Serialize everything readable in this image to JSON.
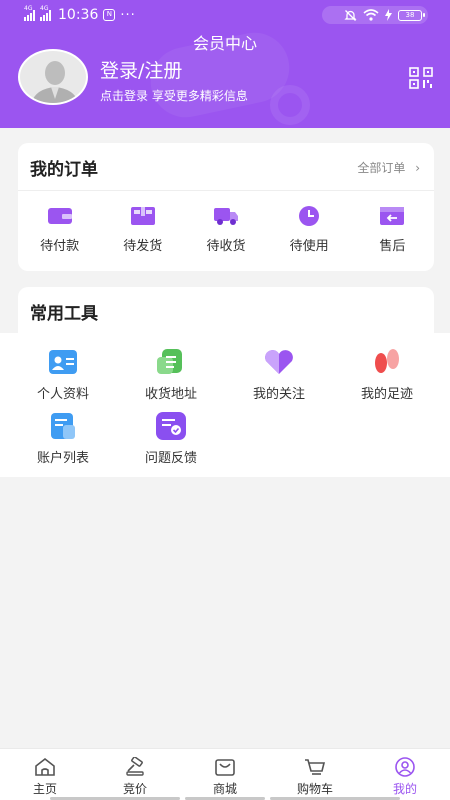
{
  "status_bar": {
    "network_1": "4G",
    "network_2": "4G",
    "time": "10:36",
    "notif_badge": "N",
    "more_dots": "···",
    "battery_level": "38"
  },
  "header": {
    "title": "会员中心",
    "login_title": "登录/注册",
    "login_subtitle": "点击登录 享受更多精彩信息",
    "qr_icon": "qr-code-icon",
    "bg_color": "#9b55f0"
  },
  "orders": {
    "title": "我的订单",
    "all_orders_label": "全部订单",
    "items": [
      {
        "label": "待付款",
        "icon": "wallet-icon"
      },
      {
        "label": "待发货",
        "icon": "package-icon"
      },
      {
        "label": "待收货",
        "icon": "truck-icon"
      },
      {
        "label": "待使用",
        "icon": "clock-icon"
      },
      {
        "label": "售后",
        "icon": "return-icon"
      }
    ]
  },
  "tools": {
    "title": "常用工具",
    "items": [
      {
        "label": "个人资料",
        "icon": "profile-card-icon"
      },
      {
        "label": "收货地址",
        "icon": "address-icon"
      },
      {
        "label": "我的关注",
        "icon": "heart-icon"
      },
      {
        "label": "我的足迹",
        "icon": "footprint-icon"
      },
      {
        "label": "账户列表",
        "icon": "account-list-icon"
      },
      {
        "label": "问题反馈",
        "icon": "feedback-icon"
      }
    ]
  },
  "bottom_nav": {
    "active_index": 4,
    "accent_color": "#9b55f0",
    "items": [
      {
        "label": "主页",
        "icon": "home-icon"
      },
      {
        "label": "竞价",
        "icon": "auction-gavel-icon"
      },
      {
        "label": "商城",
        "icon": "shop-bag-icon"
      },
      {
        "label": "购物车",
        "icon": "cart-icon"
      },
      {
        "label": "我的",
        "icon": "user-circle-icon"
      }
    ]
  }
}
